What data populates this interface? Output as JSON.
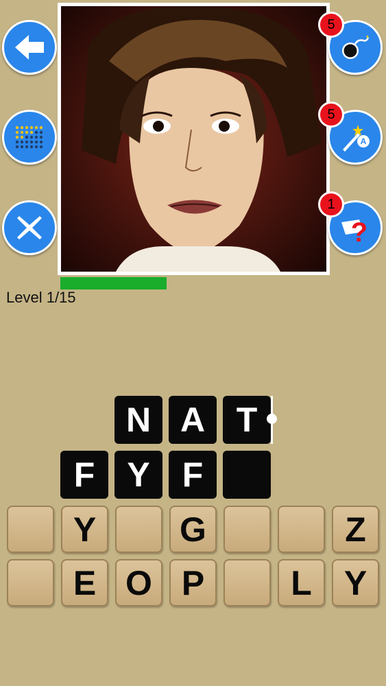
{
  "badges": {
    "bomb": "5",
    "magic": "5",
    "hint": "1"
  },
  "level_label": "Level 1/15",
  "progress_fraction": 0.39,
  "answer_slots": [
    {
      "letter": "N"
    },
    {
      "letter": "A"
    },
    {
      "letter": "T"
    },
    {
      "letter": "F"
    },
    {
      "letter": "Y"
    },
    {
      "letter": "F"
    },
    {
      "letter": ""
    }
  ],
  "letter_tiles": [
    {
      "letter": ""
    },
    {
      "letter": "Y"
    },
    {
      "letter": ""
    },
    {
      "letter": "G"
    },
    {
      "letter": ""
    },
    {
      "letter": ""
    },
    {
      "letter": "Z"
    },
    {
      "letter": ""
    },
    {
      "letter": "E"
    },
    {
      "letter": "O"
    },
    {
      "letter": "P"
    },
    {
      "letter": ""
    },
    {
      "letter": "L"
    },
    {
      "letter": "Y"
    }
  ],
  "colors": {
    "background": "#c5b486",
    "button_blue": "#2a86ea",
    "badge_red": "#e8121c",
    "progress_green": "#1aad2c"
  },
  "icons": [
    "back-arrow-icon",
    "levels-grid-icon",
    "close-x-icon",
    "bomb-icon",
    "magic-wand-icon",
    "question-hint-icon"
  ]
}
